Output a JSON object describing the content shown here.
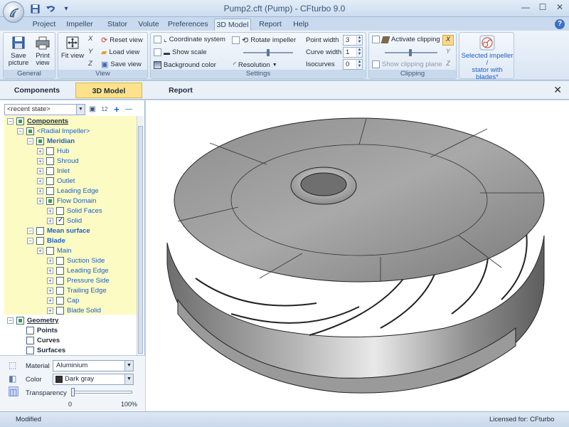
{
  "window": {
    "title": "Pump2.cft (Pump) - CFturbo 9.0",
    "controls": {
      "minimize": "—",
      "maximize": "☐",
      "close": "✕"
    },
    "help": "?"
  },
  "quick_access": {
    "undo_dropdown": "▾"
  },
  "menu_tabs": [
    "Project",
    "Impeller",
    "Stator",
    "Volute",
    "Preferences",
    "3D Model",
    "Report",
    "Help"
  ],
  "ribbon": {
    "general": {
      "label": "General",
      "save_line1": "Save",
      "save_line2": "picture",
      "print_line1": "Print",
      "print_line2": "view"
    },
    "view": {
      "label": "View",
      "fit_view": "Fit view",
      "reset_view": "Reset view",
      "load_view": "Load view",
      "save_view": "Save view",
      "axis_x": "X",
      "axis_y": "Y",
      "axis_z": "Z"
    },
    "settings": {
      "label": "Settings",
      "coordinate_system": "Coordinate system",
      "show_scale": "Show scale",
      "background_color": "Background color",
      "rotate_impeller": "Rotate impeller",
      "resolution": "Resolution",
      "point_width_label": "Point width",
      "point_width_value": "3",
      "curve_width_label": "Curve width",
      "curve_width_value": "1",
      "isocurves_label": "Isocurves",
      "isocurves_value": "0"
    },
    "clipping": {
      "label": "Clipping",
      "activate_clipping": "Activate clipping",
      "show_clipping_plane": "Show clipping plane",
      "axis_x": "X",
      "axis_y": "Y",
      "axis_z": "Z"
    },
    "selection": {
      "line1": "Selected impeller /",
      "line2": "stator with blades*"
    }
  },
  "panel_tabs": [
    "Components",
    "3D Model",
    "Report"
  ],
  "left_panel": {
    "recent_state": "<recent state>",
    "sort_label": "12",
    "add": "+",
    "remove": "—",
    "tree": [
      {
        "label": "Components",
        "level": 0,
        "check": "filled",
        "style": "bold-ul"
      },
      {
        "label": "<Radial Impeller>",
        "level": 1,
        "check": "filled",
        "style": "blue"
      },
      {
        "label": "Meridian",
        "level": 2,
        "check": "filled",
        "style": "blue-bold"
      },
      {
        "label": "Hub",
        "level": 3,
        "check": "empty",
        "style": "blue"
      },
      {
        "label": "Shroud",
        "level": 3,
        "check": "empty",
        "style": "blue"
      },
      {
        "label": "Inlet",
        "level": 3,
        "check": "empty",
        "style": "blue"
      },
      {
        "label": "Outlet",
        "level": 3,
        "check": "empty",
        "style": "blue"
      },
      {
        "label": "Leading Edge",
        "level": 3,
        "check": "empty",
        "style": "blue"
      },
      {
        "label": "Flow Domain",
        "level": 3,
        "check": "filled",
        "style": "blue"
      },
      {
        "label": "Solid Faces",
        "level": 4,
        "check": "empty",
        "style": "blue"
      },
      {
        "label": "Solid",
        "level": 4,
        "check": "checked",
        "style": "blue"
      },
      {
        "label": "Mean surface",
        "level": 2,
        "check": "empty",
        "style": "blue-bold"
      },
      {
        "label": "Blade",
        "level": 2,
        "check": "empty",
        "style": "blue-bold"
      },
      {
        "label": "Main",
        "level": 3,
        "check": "empty",
        "style": "blue"
      },
      {
        "label": "Suction Side",
        "level": 4,
        "check": "empty",
        "style": "blue"
      },
      {
        "label": "Leading Edge",
        "level": 4,
        "check": "empty",
        "style": "blue"
      },
      {
        "label": "Pressure Side",
        "level": 4,
        "check": "empty",
        "style": "blue"
      },
      {
        "label": "Trailing Edge",
        "level": 4,
        "check": "empty",
        "style": "blue"
      },
      {
        "label": "Cap",
        "level": 4,
        "check": "empty",
        "style": "blue"
      },
      {
        "label": "Blade Solid",
        "level": 4,
        "check": "empty",
        "style": "blue"
      },
      {
        "label": "Geometry",
        "level": 0,
        "check": "filled",
        "style": "bold-ul"
      },
      {
        "label": "Points",
        "level": 1,
        "check": "empty",
        "style": "bold"
      },
      {
        "label": "Curves",
        "level": 1,
        "check": "empty",
        "style": "bold"
      },
      {
        "label": "Surfaces",
        "level": 1,
        "check": "empty",
        "style": "bold"
      }
    ],
    "properties": {
      "material_label": "Material",
      "material_value": "Aluminium",
      "color_label": "Color",
      "color_value": "Dark gray",
      "color_swatch": "#333333",
      "transparency_label": "Transparency",
      "transparency_min": "0",
      "transparency_max": "100%",
      "transparency_value": 0
    }
  },
  "status": {
    "left": "Modified",
    "right": "Licensed for: CFturbo"
  },
  "colors": {
    "accent_tab": "#fde28b",
    "tree_highlight": "#fcfbc4",
    "ribbon": "#dbe6f4"
  }
}
